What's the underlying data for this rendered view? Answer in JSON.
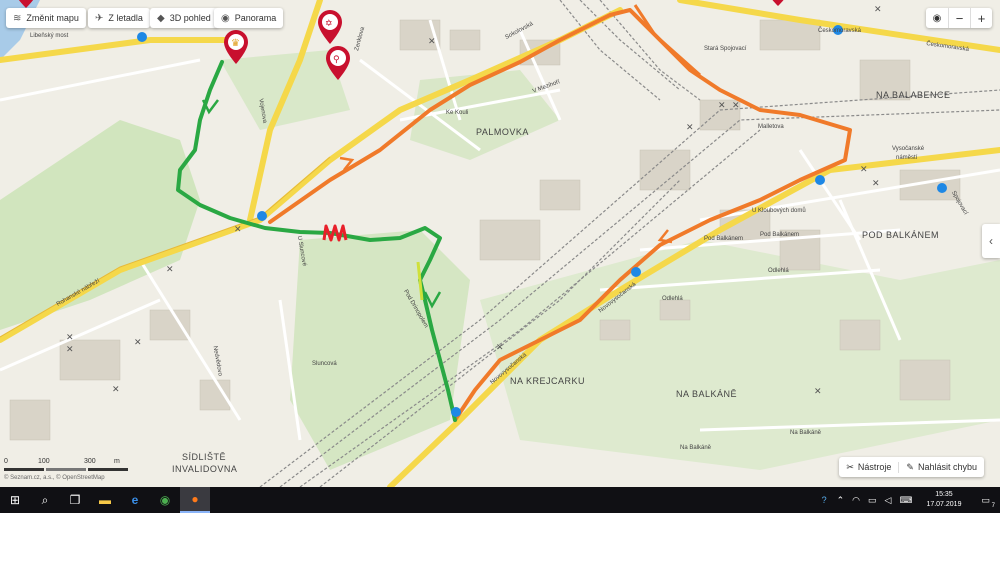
{
  "toolbar": {
    "change_map": "Změnit mapu",
    "from_plane": "Z letadla",
    "view_3d": "3D pohled",
    "panorama": "Panorama"
  },
  "zoom": {
    "locate_icon": "target-icon",
    "minus": "−",
    "plus": "+"
  },
  "side_toggle": "‹",
  "bottom_tools": {
    "tools": "Nástroje",
    "report_error": "Nahlásit chybu"
  },
  "scale": {
    "label_100": "100",
    "label_200": "300",
    "unit": "m"
  },
  "copyright": "© Seznam.cz, a.s., © OpenStreetMap",
  "areas": {
    "palmovka": "PALMOVKA",
    "na_balabence": "NA BALABENCE",
    "pod_balkanem": "POD BALKÁNEM",
    "na_krejcarku": "NA KREJCARKU",
    "na_balkane": "NA BALKÁNĚ",
    "sidliste": "SÍDLIŠTĚ",
    "invalidovna": "INVALIDOVNA",
    "vysocanske": "Vysočanské",
    "namesti": "náměstí",
    "sluncova": "Sluncová"
  },
  "streets": {
    "libensky_most": "Libeňský most",
    "ceskomoravska": "Českomoravská",
    "sokolovska": "Sokolovská",
    "rohanske": "Rohanské nábřeží",
    "novovysocanska": "Novovysočanská",
    "ke_kouli": "Ke Kouli",
    "v_mezihori": "V Mezihoří",
    "malletova": "Malletova",
    "u_kloubovych_domu": "U Kloubových domů",
    "pod_balkanem_st": "Pod Balkánem",
    "odlehla": "Odlehlá",
    "na_balkane_st": "Na Balkáně",
    "u_sluncove": "U Sluncové",
    "drinopolska": "Pod Drinopolem",
    "stara_spojovaci": "Stará Spojovací",
    "spojovaci": "Spojovací",
    "nedvedovo": "Nedvědovo",
    "zenklova": "Zenklova",
    "vojenova": "Vojenova"
  },
  "taskbar": {
    "start_icon": "windows-icon",
    "search_icon": "search-icon",
    "taskview_icon": "task-view-icon",
    "apps": [
      "file-explorer-icon",
      "edge-icon",
      "chrome-icon",
      "firefox-icon"
    ],
    "time": "15:35",
    "date": "17.07.2019",
    "notification_count": "7"
  },
  "colors": {
    "route_green": "#2aa843",
    "route_orange": "#f07a2a",
    "highlight_red": "#e8202a",
    "major_road": "#f5d84a",
    "green_area": "#c9e2b4",
    "rail": "#8a8a8a"
  }
}
